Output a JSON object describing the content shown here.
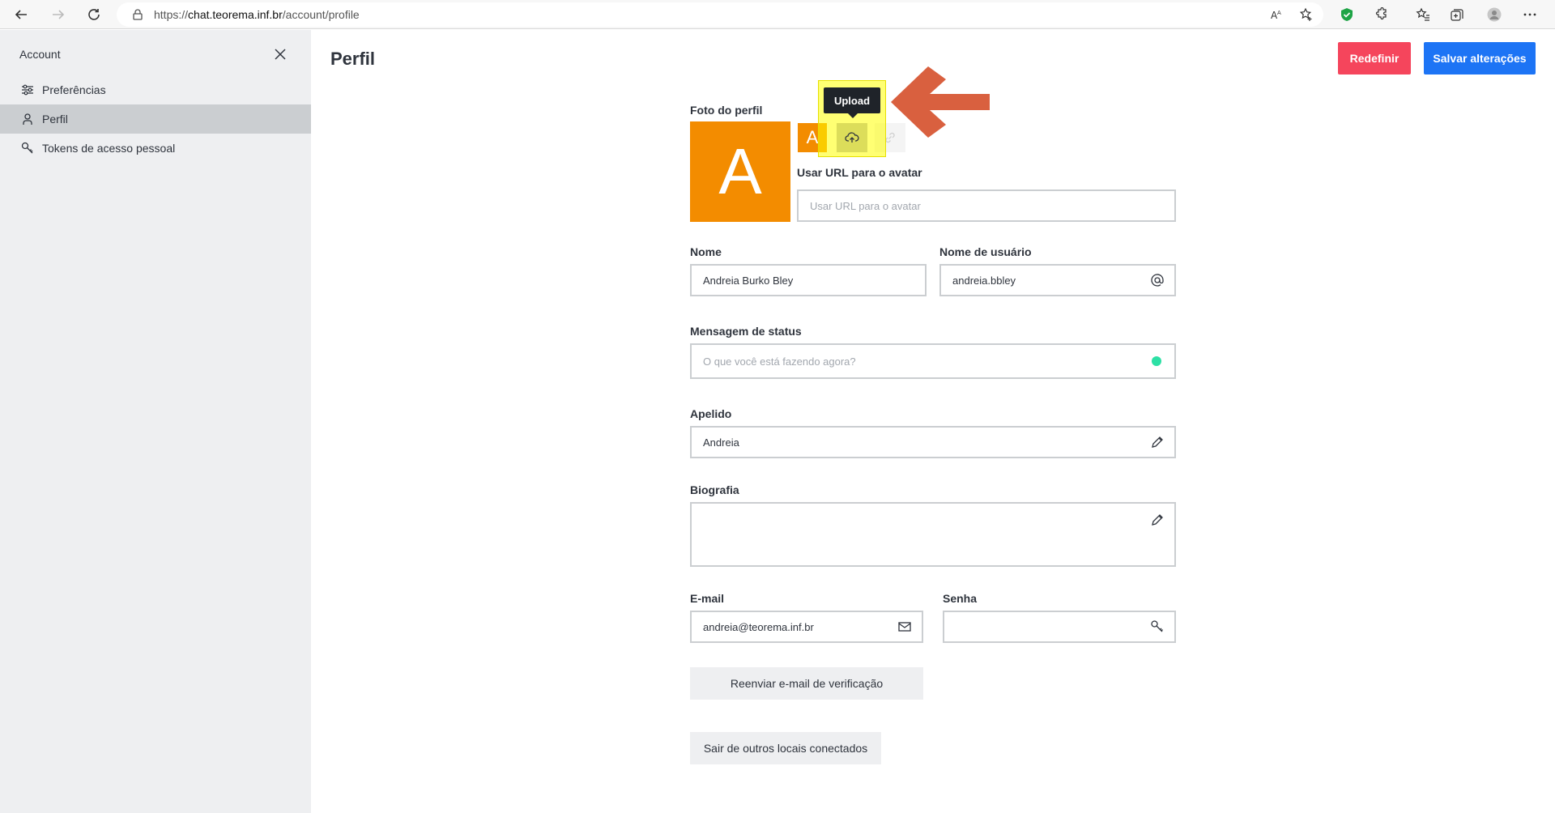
{
  "browser": {
    "url_prefix": "https://",
    "url_host": "chat.teorema.inf.br",
    "url_path": "/account/profile"
  },
  "sidebar": {
    "title": "Account",
    "items": [
      {
        "label": "Preferências",
        "icon": "sliders-icon"
      },
      {
        "label": "Perfil",
        "icon": "user-icon",
        "active": true
      },
      {
        "label": "Tokens de acesso pessoal",
        "icon": "key-icon"
      }
    ]
  },
  "header": {
    "title": "Perfil",
    "reset_label": "Redefinir",
    "save_label": "Salvar alterações"
  },
  "profile": {
    "photo_label": "Foto do perfil",
    "avatar_letter": "A",
    "upload_tooltip": "Upload",
    "avatar_url_label": "Usar URL para o avatar",
    "avatar_url_placeholder": "Usar URL para o avatar",
    "name_label": "Nome",
    "name_value": "Andreia Burko Bley",
    "username_label": "Nome de usuário",
    "username_value": "andreia.bbley",
    "status_label": "Mensagem de status",
    "status_placeholder": "O que você está fazendo agora?",
    "nickname_label": "Apelido",
    "nickname_value": "Andreia",
    "bio_label": "Biografia",
    "email_label": "E-mail",
    "email_value": "andreia@teorema.inf.br",
    "password_label": "Senha",
    "resend_label": "Reenviar e-mail de verificação",
    "logout_others_label": "Sair de outros locais conectados"
  },
  "colors": {
    "accent": "#1d74f5",
    "danger": "#f5455c",
    "avatar": "#f38c00",
    "status_online": "#2de0a5",
    "annotation_arrow": "#d9603f"
  }
}
